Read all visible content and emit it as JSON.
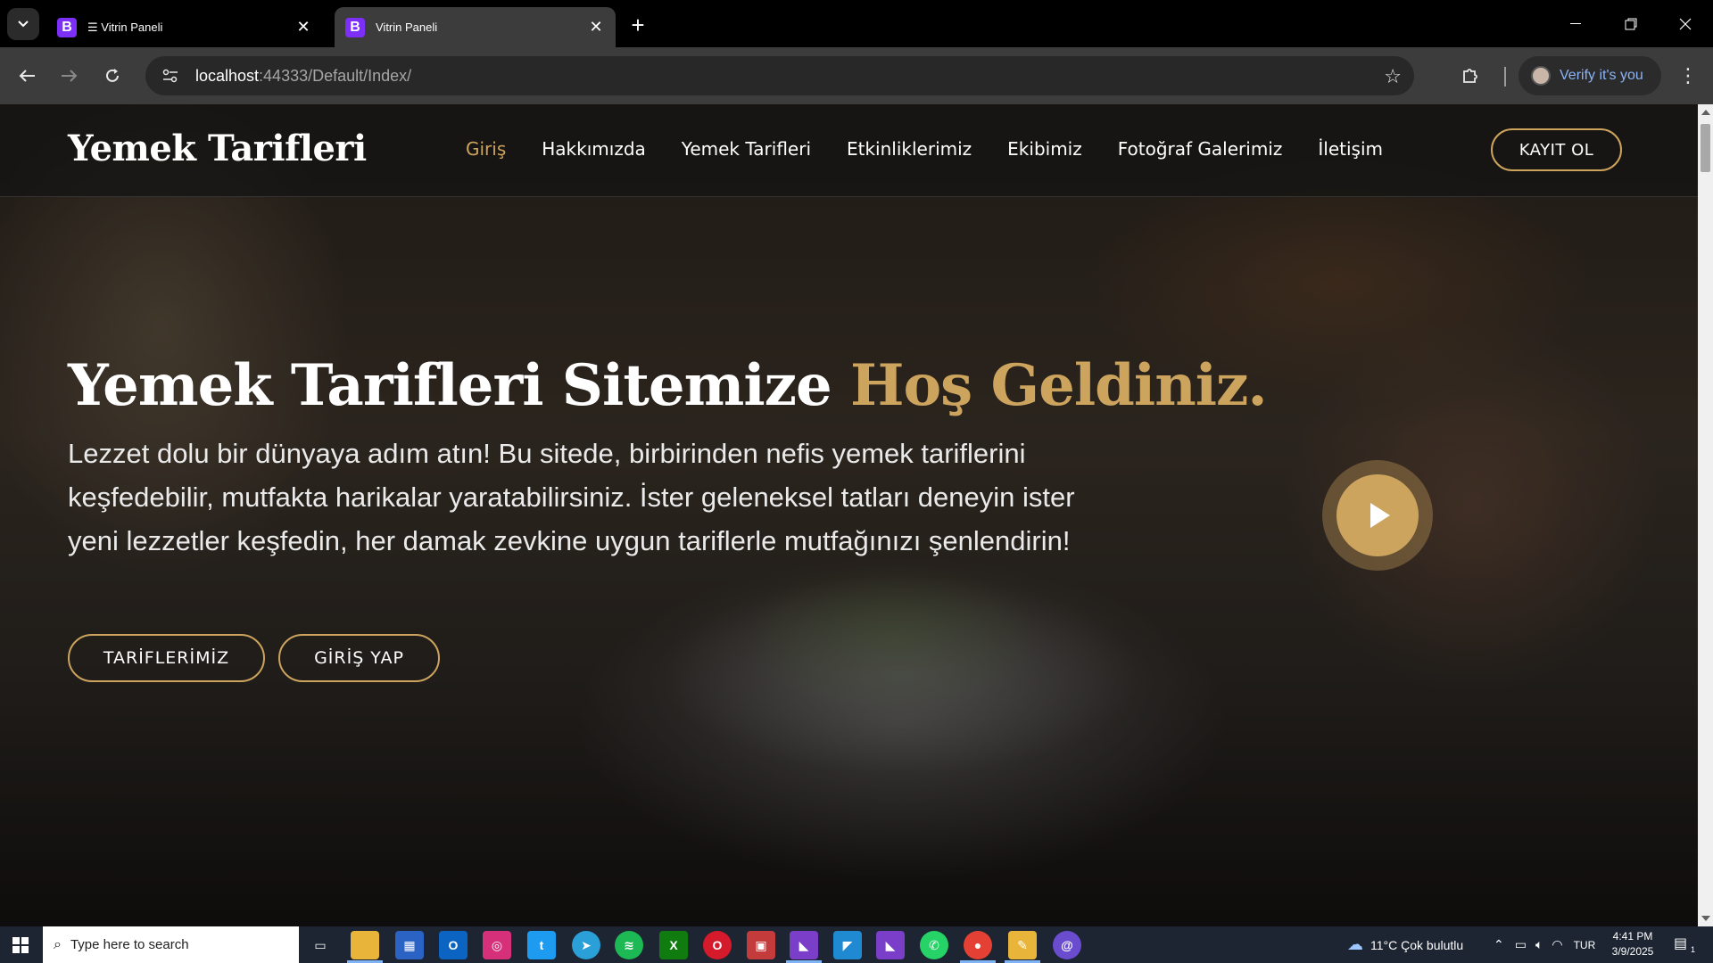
{
  "browser": {
    "tabs": [
      {
        "title": "☰ Vitrin Paneli",
        "favicon": "B",
        "active": false
      },
      {
        "title": "Vitrin Paneli",
        "favicon": "B",
        "active": true
      }
    ],
    "url_host": "localhost",
    "url_path": ":44333/Default/Index/",
    "profile_label": "Verify it's you"
  },
  "site": {
    "logo": "Yemek Tarifleri",
    "nav": [
      {
        "label": "Giriş",
        "active": true
      },
      {
        "label": "Hakkımızda",
        "active": false
      },
      {
        "label": "Yemek Tarifleri",
        "active": false
      },
      {
        "label": "Etkinliklerimiz",
        "active": false
      },
      {
        "label": "Ekibimiz",
        "active": false
      },
      {
        "label": "Fotoğraf Galerimiz",
        "active": false
      },
      {
        "label": "İletişim",
        "active": false
      }
    ],
    "register_label": "KAYIT OL",
    "hero": {
      "title_main": "Yemek Tarifleri Sitemize ",
      "title_accent": "Hoş Geldiniz.",
      "text": "Lezzet dolu bir dünyaya adım atın! Bu sitede, birbirinden nefis yemek tariflerini keşfedebilir, mutfakta harikalar yaratabilirsiniz. İster geleneksel tatları deneyin ister yeni lezzetler keşfedin, her damak zevkine uygun tariflerle mutfağınızı şenlendirin!",
      "btn_recipes": "TARİFLERİMİZ",
      "btn_login": "GİRİŞ YAP"
    },
    "accent_color": "#cda45e"
  },
  "taskbar": {
    "search_placeholder": "Type here to search",
    "weather": "11°C  Çok bulutlu",
    "language": "TUR",
    "time": "4:41 PM",
    "date": "3/9/2025",
    "notification_count": "1"
  }
}
